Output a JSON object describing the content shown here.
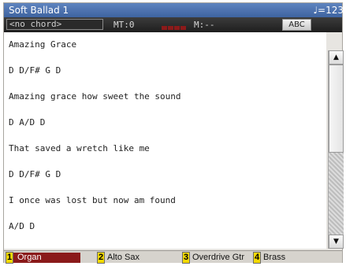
{
  "titlebar": {
    "title": "Soft Ballad 1",
    "tempo": "♩=123"
  },
  "status": {
    "chord": "<no chord>",
    "mt": "MT:0",
    "measure": "M:--",
    "abc_label": "ABC"
  },
  "lyrics": [
    "Amazing Grace",
    "D D/F# G D",
    "Amazing grace how sweet the sound",
    "D A/D D",
    "That saved a wretch like me",
    "D D/F# G D",
    "I once was lost but now am found",
    "A/D D"
  ],
  "tracks": [
    {
      "num": "1",
      "name": "Organ"
    },
    {
      "num": "2",
      "name": "Alto Sax"
    },
    {
      "num": "3",
      "name": "Overdrive Gtr"
    },
    {
      "num": "4",
      "name": "Brass"
    }
  ],
  "colors": {
    "titlebar": "#4a6fae",
    "status_bg": "#2a2a2a",
    "active_track": "#8a1a1a",
    "track_number": "#f3d900"
  }
}
